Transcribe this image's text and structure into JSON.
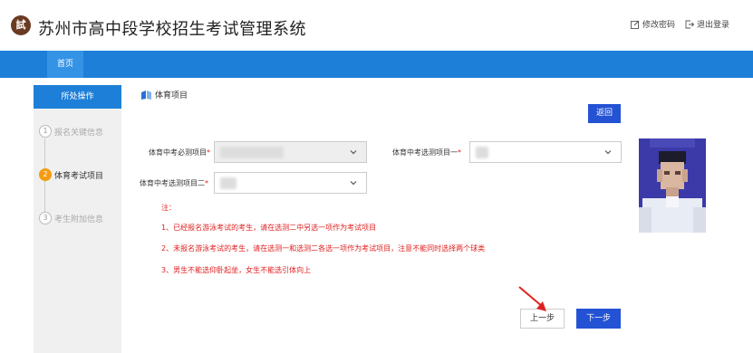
{
  "header": {
    "logo_char": "試",
    "title": "苏州市高中段学校招生考试管理系统",
    "change_password": "修改密码",
    "logout": "退出登录"
  },
  "nav": {
    "home": "首页"
  },
  "sidebar": {
    "title": "所处操作",
    "steps": [
      {
        "num": "1",
        "label": "报名关键信息"
      },
      {
        "num": "2",
        "label": "体育考试项目"
      },
      {
        "num": "3",
        "label": "考生附加信息"
      }
    ]
  },
  "section": {
    "title": "体育项目"
  },
  "buttons": {
    "back": "返回",
    "prev": "上一步",
    "next": "下一步"
  },
  "form": {
    "required_label": "体育中考必测项目",
    "elective1_label": "体育中考选测项目一",
    "elective2_label": "体育中考选测项目二",
    "required_mark": "*"
  },
  "notes": {
    "title": "注：",
    "items": [
      "1、已经报名游泳考试的考生，请在选测二中另选一项作为考试项目",
      "2、未报名游泳考试的考生，请在选测一和选测二各选一项作为考试项目，注意不能同时选择两个球类",
      "3、男生不能选仰卧起坐，女生不能选引体向上"
    ]
  },
  "colors": {
    "brand": "#1e7fd8",
    "primary_button": "#2452d4",
    "note_text": "#e02020",
    "active_step": "#f39c12"
  }
}
